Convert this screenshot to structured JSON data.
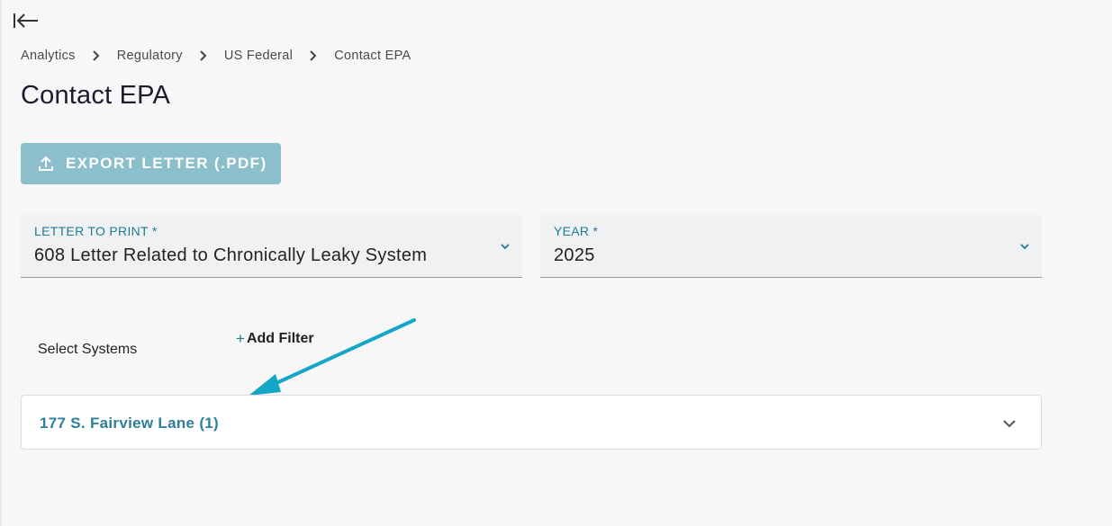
{
  "breadcrumb": {
    "items": [
      "Analytics",
      "Regulatory",
      "US Federal",
      "Contact EPA"
    ]
  },
  "page": {
    "title": "Contact EPA"
  },
  "toolbar": {
    "export_label": "EXPORT LETTER (.PDF)"
  },
  "fields": {
    "letter": {
      "label": "LETTER TO PRINT *",
      "value": "608 Letter Related to Chronically Leaky System"
    },
    "year": {
      "label": "YEAR *",
      "value": "2025"
    }
  },
  "systems": {
    "label": "Select Systems",
    "add_filter_label": "Add Filter",
    "add_filter_icon": "+",
    "items": [
      {
        "title": "177 S. Fairview Lane (1)"
      }
    ]
  },
  "colors": {
    "accent": "#1f7a94",
    "export_button": "#8bbfcb",
    "annotation_arrow": "#13a6c6"
  },
  "icons": {
    "collapse": "collapse-sidebar-icon",
    "export": "upload-icon",
    "select_chevron": "chevron-down-icon"
  }
}
